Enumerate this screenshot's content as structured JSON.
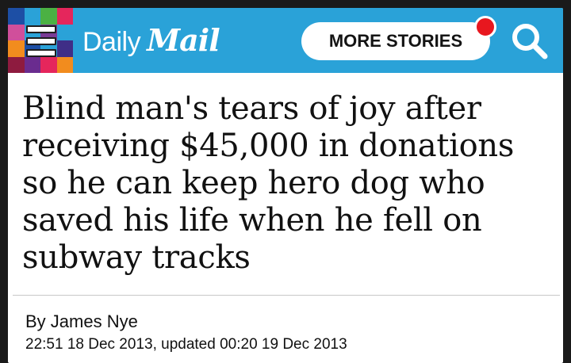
{
  "header": {
    "brand": {
      "daily": "Daily",
      "mail": "Mail"
    },
    "more_stories_label": "MORE STORIES",
    "menu_icon": "hamburger-menu-icon",
    "search_icon": "search-icon",
    "notification_badge_color": "#e8171f",
    "background_color": "#2aa2d8"
  },
  "article": {
    "headline": "Blind man's tears of joy after receiving $45,000 in donations so he can keep hero dog who saved his life when he fell on subway tracks",
    "byline": "By James Nye",
    "timestamp": "22:51 18 Dec 2013, updated 00:20 19 Dec 2013"
  }
}
